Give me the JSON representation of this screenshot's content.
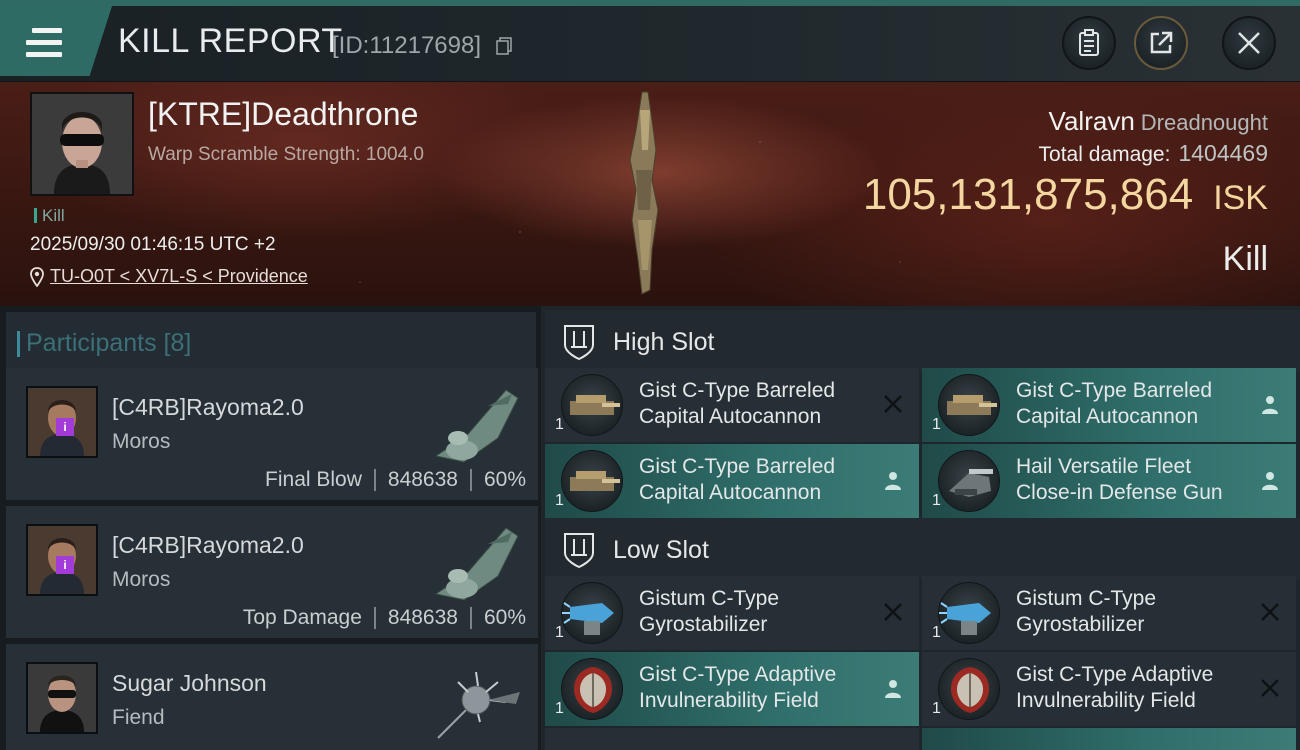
{
  "header": {
    "title": "KILL REPORT",
    "kill_id": "[ID:11217698]",
    "icons": [
      "menu-icon",
      "copy-icon",
      "clipboard-icon",
      "share-icon",
      "close-icon"
    ]
  },
  "victim": {
    "name": "[KTRE]Deadthrone",
    "warp_scramble": "Warp Scramble Strength: 1004.0",
    "tag": "Kill",
    "datetime": "2025/09/30 01:46:15 UTC +2",
    "location": "TU-O0T < XV7L-S < Providence",
    "ship": "Valravn",
    "ship_class": "Dreadnought",
    "total_damage_label": "Total damage:",
    "total_damage": "1404469",
    "isk_value": "105,131,875,864",
    "isk_unit": "ISK",
    "result": "Kill"
  },
  "participants": {
    "label": "Participants [8]",
    "items": [
      {
        "name": "[C4RB]Rayoma2.0",
        "ship": "Moros",
        "role": "Final Blow",
        "damage": "848638",
        "percent": "60%",
        "badge": "i"
      },
      {
        "name": "[C4RB]Rayoma2.0",
        "ship": "Moros",
        "role": "Top Damage",
        "damage": "848638",
        "percent": "60%",
        "badge": "i"
      },
      {
        "name": "Sugar Johnson",
        "ship": "Fiend"
      }
    ]
  },
  "fitting": {
    "high_slot": {
      "label": "High Slot",
      "modules": [
        {
          "name_line1": "Gist C-Type Barreled",
          "name_line2": "Capital Autocannon",
          "qty": "1",
          "state": "destroyed"
        },
        {
          "name_line1": "Gist C-Type Barreled",
          "name_line2": "Capital Autocannon",
          "qty": "1",
          "state": "dropped"
        },
        {
          "name_line1": "Gist C-Type Barreled",
          "name_line2": "Capital Autocannon",
          "qty": "1",
          "state": "dropped"
        },
        {
          "name_line1": "Hail Versatile Fleet",
          "name_line2": "Close-in Defense Gun",
          "qty": "1",
          "state": "dropped"
        }
      ]
    },
    "low_slot": {
      "label": "Low Slot",
      "modules": [
        {
          "name_line1": "Gistum C-Type",
          "name_line2": "Gyrostabilizer",
          "qty": "1",
          "state": "destroyed"
        },
        {
          "name_line1": "Gistum C-Type",
          "name_line2": "Gyrostabilizer",
          "qty": "1",
          "state": "destroyed"
        },
        {
          "name_line1": "Gist C-Type Adaptive",
          "name_line2": "Invulnerability Field",
          "qty": "1",
          "state": "dropped"
        },
        {
          "name_line1": "Gist C-Type Adaptive",
          "name_line2": "Invulnerability Field",
          "qty": "1",
          "state": "destroyed"
        }
      ]
    }
  },
  "colors": {
    "accent_teal": "#2f6b65",
    "isk_gold": "#f4d7a0",
    "badge_purple": "#a33bd8",
    "highlight_row": "#2f6e6a"
  }
}
